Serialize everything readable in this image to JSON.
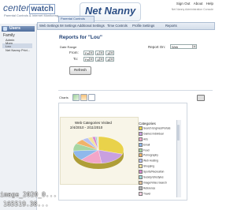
{
  "header": {
    "logo_text": "center",
    "logo_box": "watch",
    "logo_sub": "Parental Controls & Internet Monitoring",
    "brand": "Net Nanny",
    "links": [
      "Sign Out",
      "About",
      "Help"
    ],
    "sub": "Net Nanny Administration Console"
  },
  "sidebar": {
    "title": "Users",
    "items": [
      "Family",
      "Admin",
      "Mom",
      "Lou",
      "Net Nanny Privi..."
    ],
    "selected_index": 3
  },
  "tabs": {
    "active": "Parental Controls",
    "items": [
      "Web Settings",
      "IM Settings",
      "Additional Settings",
      "Time Controls",
      "Profile Settings",
      "Reports"
    ]
  },
  "report": {
    "title": "Reports for \"Lou\"",
    "date_range_label": "Date Range",
    "from_label": "From:",
    "from_month": "Feb",
    "from_day": "4",
    "from_year": "10",
    "to_label": "To:",
    "to_month": "Feb",
    "to_day": "11",
    "to_year": "10",
    "refresh_label": "Refresh",
    "report_for_label": "Report On:",
    "report_for_value": "Web"
  },
  "charts": {
    "label": "Charts"
  },
  "chart_data": {
    "type": "pie",
    "title": "Web Categories Visited",
    "subtitle": "2/4/2010 - 2/11/2010",
    "legend_title": "Categories",
    "categories": [
      "Search Engines/Portals",
      "Games Individual",
      "Arts",
      "Email",
      "Food",
      "Pornography",
      "Web Hosting",
      "Shopping",
      "Sports/Recreation",
      "Society/Lifestyles",
      "Image/Video Search",
      "Reference",
      "Travel"
    ],
    "colors": [
      "#e9d24a",
      "#c9a0e0",
      "#f2a6c9",
      "#8fb8ec",
      "#a6d6a2",
      "#f0b36a",
      "#b9c3f2",
      "#f4e39c",
      "#d88bd0",
      "#9ed7d6",
      "#e0c09a",
      "#b5b5b5",
      "#f8cfe0"
    ],
    "values": [
      30,
      18,
      14,
      12,
      9,
      6,
      4,
      3,
      2,
      1,
      0.5,
      0.3,
      0.2
    ],
    "legend_placement": "right"
  },
  "overlay": {
    "line1": "image_2020_0...",
    "line2": "165519.38..."
  }
}
